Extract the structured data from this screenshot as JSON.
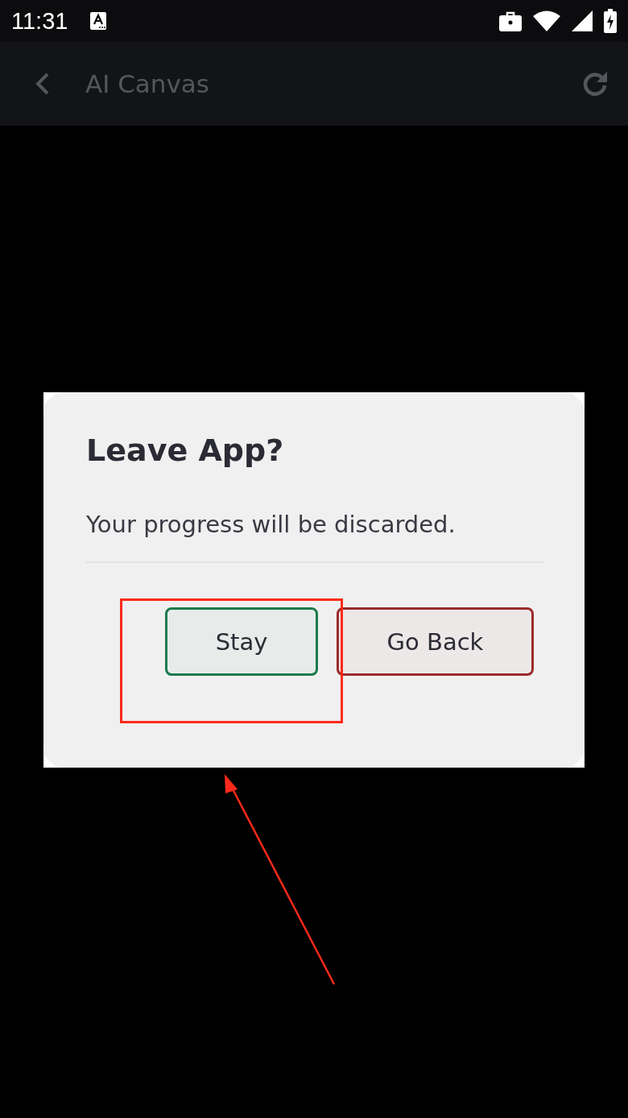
{
  "status_bar": {
    "time": "11:31"
  },
  "app_bar": {
    "title": "AI Canvas"
  },
  "dialog": {
    "title": "Leave App?",
    "message": "Your progress will be discarded.",
    "buttons": [
      {
        "label": "Stay",
        "color": "#1b7a4c"
      },
      {
        "label": "Go Back",
        "color": "#9c2b2b"
      }
    ]
  },
  "annotations": [
    {
      "kind": "box"
    },
    {
      "kind": "arrow"
    }
  ]
}
